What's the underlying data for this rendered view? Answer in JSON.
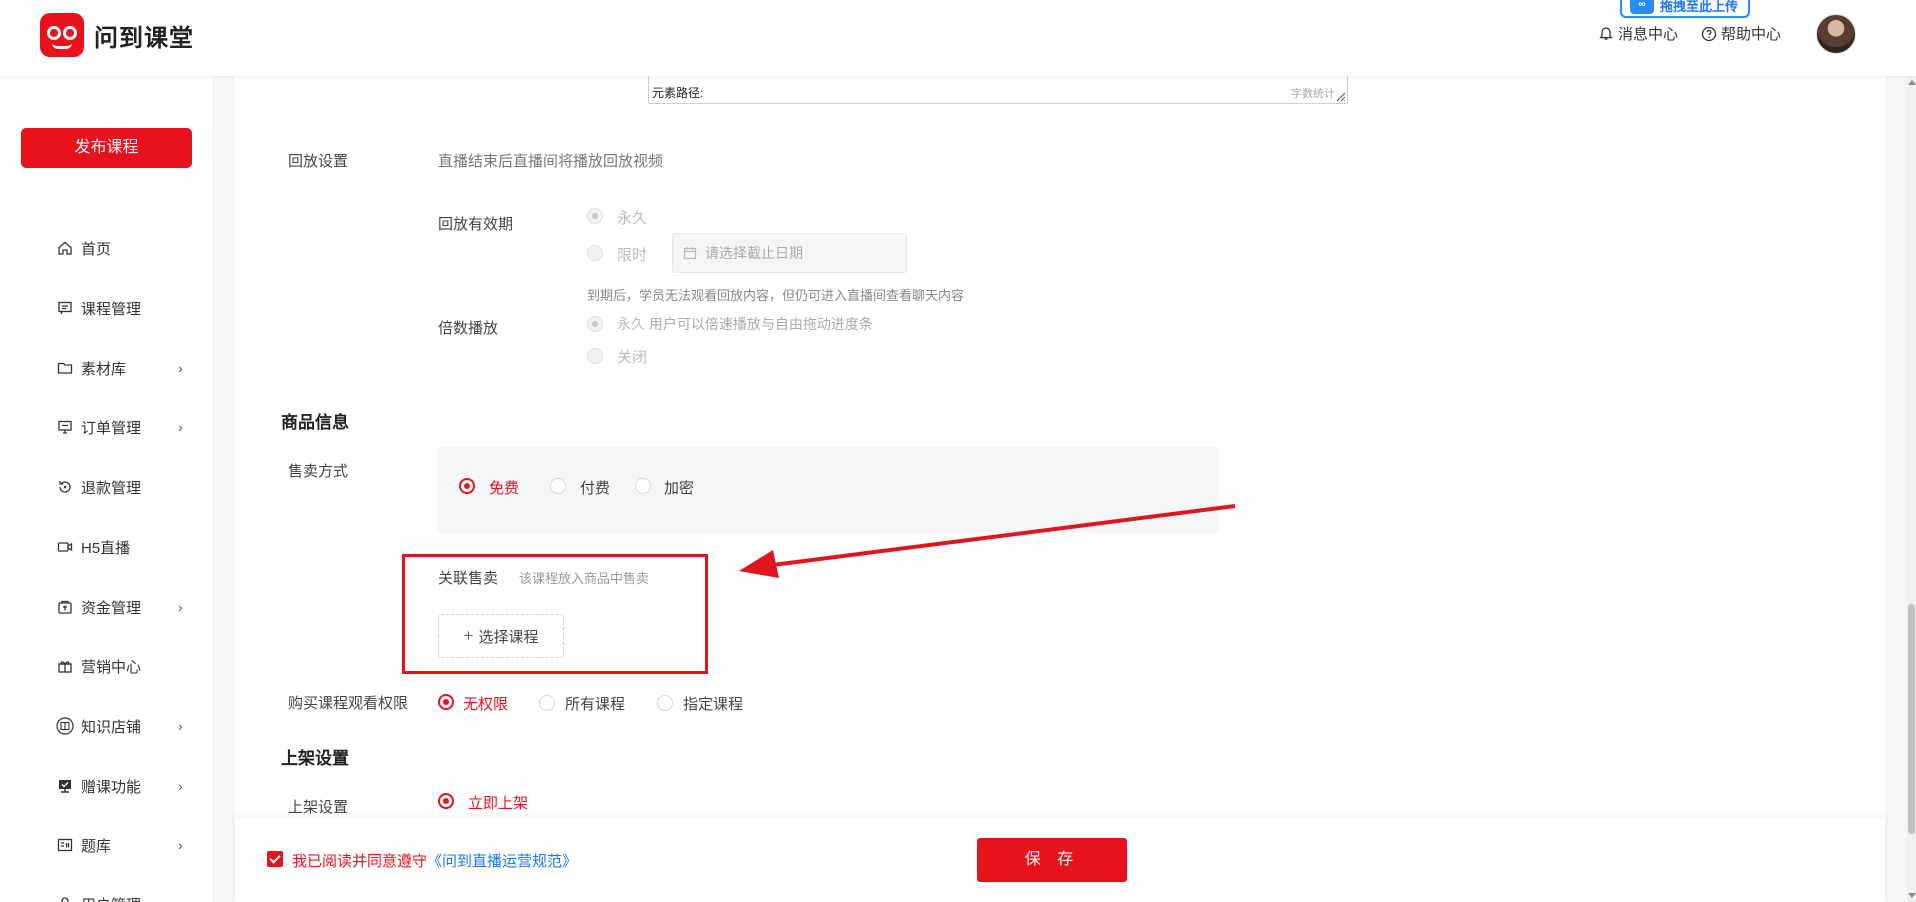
{
  "header": {
    "logo_text": "问到课堂",
    "upload_badge": "拖拽至此上传",
    "messages_label": "消息中心",
    "help_label": "帮助中心"
  },
  "sidebar": {
    "publish_label": "发布课程",
    "items": [
      {
        "label": "首页",
        "icon": "home-icon",
        "has_submenu": false
      },
      {
        "label": "课程管理",
        "icon": "course-icon",
        "has_submenu": false
      },
      {
        "label": "素材库",
        "icon": "folder-icon",
        "has_submenu": true
      },
      {
        "label": "订单管理",
        "icon": "order-icon",
        "has_submenu": true
      },
      {
        "label": "退款管理",
        "icon": "refund-icon",
        "has_submenu": false
      },
      {
        "label": "H5直播",
        "icon": "video-icon",
        "has_submenu": false
      },
      {
        "label": "资金管理",
        "icon": "wallet-icon",
        "has_submenu": true
      },
      {
        "label": "营销中心",
        "icon": "gift-icon",
        "has_submenu": false
      },
      {
        "label": "知识店铺",
        "icon": "shop-icon",
        "has_submenu": true
      },
      {
        "label": "赠课功能",
        "icon": "gift-course-icon",
        "has_submenu": true
      },
      {
        "label": "题库",
        "icon": "question-bank-icon",
        "has_submenu": true
      },
      {
        "label": "用户管理",
        "icon": "user-icon",
        "has_submenu": false
      }
    ]
  },
  "editor": {
    "element_path": "元素路径:",
    "word_count": "字数统计"
  },
  "playback": {
    "label": "回放设置",
    "description": "直播结束后直播间将播放回放视频",
    "validity_label": "回放有效期",
    "validity_forever": "永久",
    "validity_limited": "限时",
    "date_placeholder": "请选择截止日期",
    "validity_note": "到期后，学员无法观看回放内容，但仍可进入直播间查看聊天内容",
    "speed_label": "倍数播放",
    "speed_forever": "永久",
    "speed_forever_note": "用户可以倍速播放与自由拖动进度条",
    "speed_off": "关闭"
  },
  "product": {
    "section_title": "商品信息",
    "sale_mode_label": "售卖方式",
    "sale_options": [
      "免费",
      "付费",
      "加密"
    ],
    "sale_selected": "免费",
    "related_label": "关联售卖",
    "related_hint": "该课程放入商品中售卖",
    "select_course_label": "选择课程",
    "permission_label": "购买课程观看权限",
    "permission_options": [
      "无权限",
      "所有课程",
      "指定课程"
    ],
    "permission_selected": "无权限"
  },
  "listing": {
    "section_title": "上架设置",
    "label": "上架设置",
    "option": "立即上架"
  },
  "footer": {
    "agree_text": "我已阅读并同意遵守",
    "agree_link": "《问到直播运营规范》",
    "save_label": "保 存"
  },
  "colors": {
    "brand": "#e8121d",
    "link": "#1677ff",
    "annotation": "#e0161f"
  }
}
